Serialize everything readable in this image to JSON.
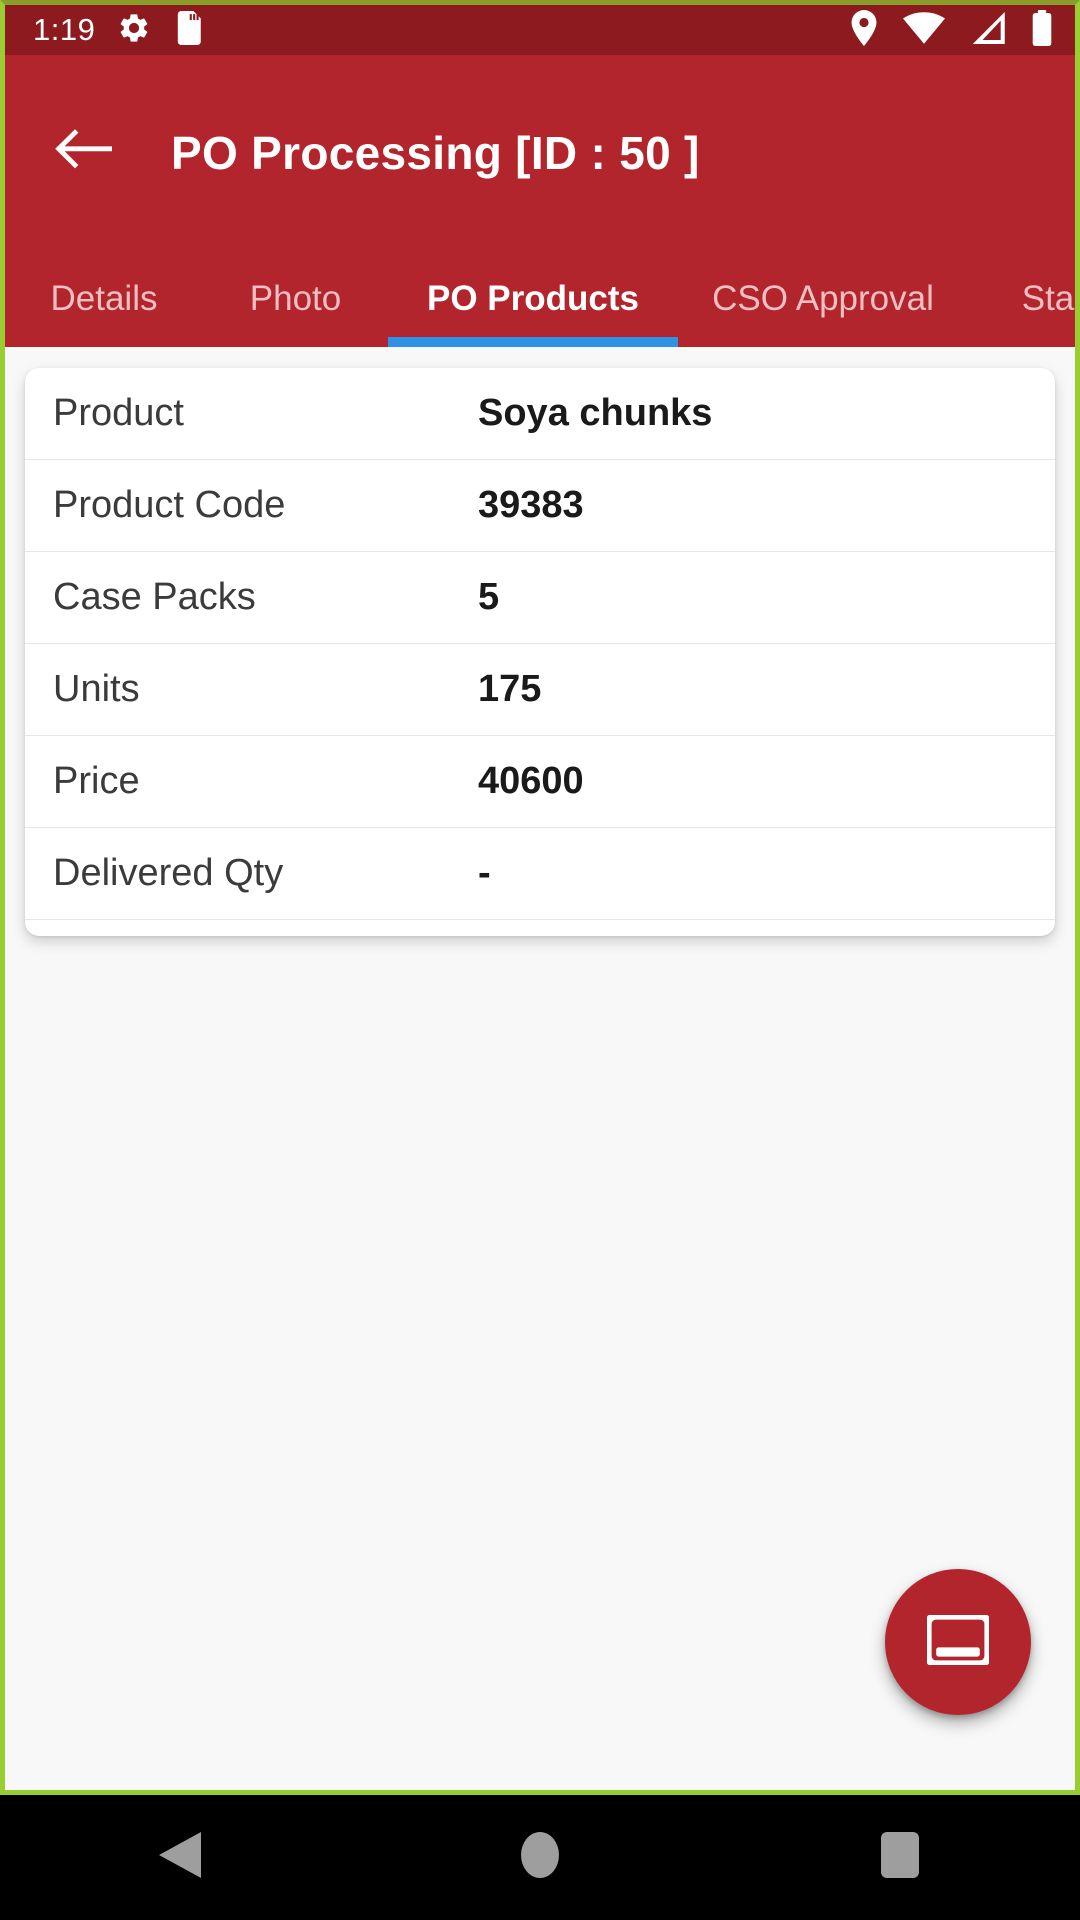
{
  "status_bar": {
    "time": "1:19",
    "left_icons": [
      "gear-icon",
      "sd-card-icon"
    ],
    "right_icons": [
      "location-pin-icon",
      "wifi-icon",
      "signal-icon",
      "battery-icon"
    ],
    "background_color": "#8C1A1E"
  },
  "app_bar": {
    "back_icon": "arrow-left-icon",
    "title": "PO Processing  [ID : 50 ]",
    "background_color": "#B3252C"
  },
  "tabs": {
    "items": [
      {
        "label": "Details",
        "active": false
      },
      {
        "label": "Photo",
        "active": false
      },
      {
        "label": "PO Products",
        "active": true
      },
      {
        "label": "CSO Approval",
        "active": false
      },
      {
        "label": "Sta",
        "active": false
      }
    ],
    "indicator_color": "#2E93E6",
    "active_label_color": "#FFFFFF",
    "inactive_label_color": "#F0BFC1"
  },
  "product_card": {
    "rows": [
      {
        "label": "Product",
        "value": "Soya chunks"
      },
      {
        "label": "Product Code",
        "value": "39383"
      },
      {
        "label": "Case Packs",
        "value": "5"
      },
      {
        "label": "Units",
        "value": "175"
      },
      {
        "label": "Price",
        "value": "40600"
      },
      {
        "label": "Delivered Qty",
        "value": "-"
      }
    ]
  },
  "fab": {
    "icon": "card-icon",
    "color": "#B3252C"
  },
  "nav_bar": {
    "buttons": [
      "back-triangle-icon",
      "home-circle-icon",
      "recents-square-icon"
    ],
    "icon_color": "#9E9E9E",
    "background_color": "#000000"
  },
  "window": {
    "border_color": "#9ACD32",
    "content_background": "#F8F8F8"
  }
}
